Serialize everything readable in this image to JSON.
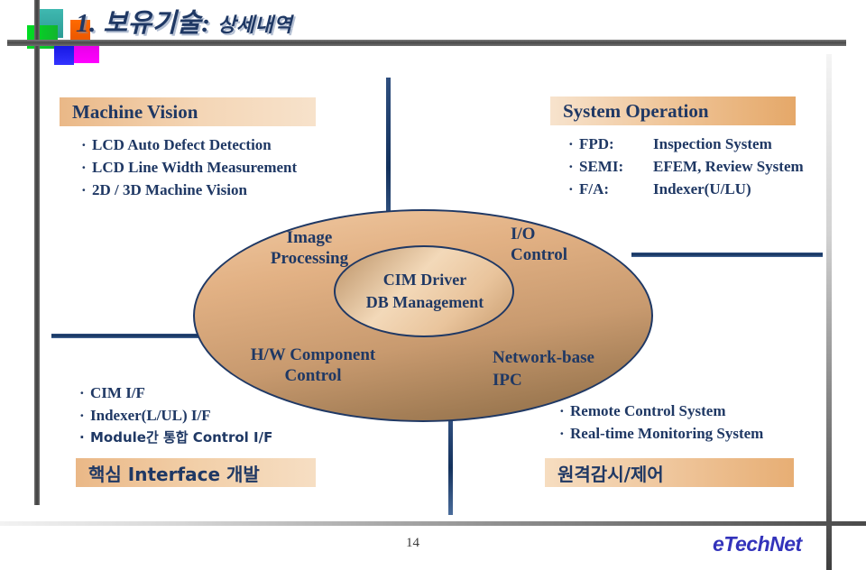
{
  "slide": {
    "title_number": "1.",
    "title_main": "보유기술:",
    "title_sub": "상세내역",
    "page_number": "14",
    "brand": "eTechNet",
    "accent_navy": "#1f3864",
    "accent_tan": "#e5a869",
    "brand_color": "#3333bb"
  },
  "machine_vision": {
    "heading": "Machine Vision",
    "items": [
      "LCD Auto Defect Detection",
      "LCD Line Width Measurement",
      "2D / 3D Machine Vision"
    ]
  },
  "system_operation": {
    "heading": "System Operation",
    "rows": [
      {
        "key": "FPD:",
        "value": "Inspection System"
      },
      {
        "key": "SEMI:",
        "value": "EFEM, Review System"
      },
      {
        "key": "F/A:",
        "value": "Indexer(U/LU)"
      }
    ]
  },
  "core_interface": {
    "items": [
      "CIM I/F",
      "Indexer(L/UL) I/F",
      "Module간 통합 Control I/F"
    ],
    "banner": "핵심 Interface 개발"
  },
  "remote_control": {
    "items": [
      "Remote Control System",
      "Real-time Monitoring System"
    ],
    "banner": "원격감시/제어"
  },
  "core_ellipse": {
    "image_processing_line1": "Image",
    "image_processing_line2": "Processing",
    "io_control_line1": "I/O",
    "io_control_line2": "Control",
    "center_line1": "CIM Driver",
    "center_line2": "DB Management",
    "hw_component_line1": "H/W Component",
    "hw_component_line2": "Control",
    "network_line1": "Network-base",
    "network_line2": "IPC"
  }
}
